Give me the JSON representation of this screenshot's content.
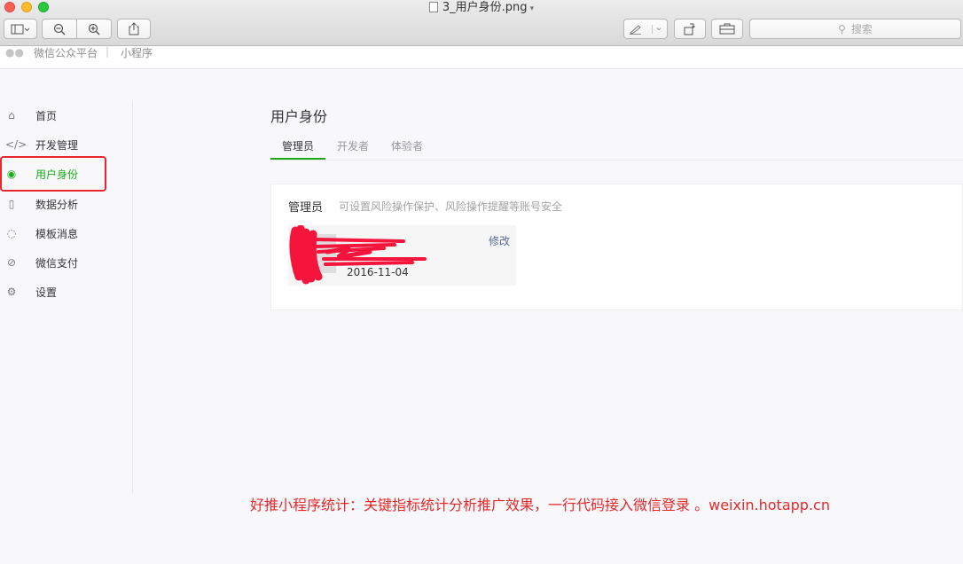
{
  "window": {
    "title": "3_用户身份.png",
    "search_placeholder": "搜索"
  },
  "topnav": {
    "brand": "微信公众平台",
    "separator": "|",
    "section": "小程序"
  },
  "sidebar": {
    "items": [
      {
        "label": "首页",
        "icon": "home-icon"
      },
      {
        "label": "开发管理",
        "icon": "code-icon"
      },
      {
        "label": "用户身份",
        "icon": "user-icon"
      },
      {
        "label": "数据分析",
        "icon": "chart-doc-icon"
      },
      {
        "label": "模板消息",
        "icon": "message-icon"
      },
      {
        "label": "微信支付",
        "icon": "payment-icon"
      },
      {
        "label": "设置",
        "icon": "gear-icon"
      }
    ],
    "active_index": 2
  },
  "main": {
    "title": "用户身份",
    "tabs": [
      {
        "label": "管理员"
      },
      {
        "label": "开发者"
      },
      {
        "label": "体验者"
      }
    ],
    "card": {
      "label": "管理员",
      "description": "可设置风险操作保护、风险操作提醒等账号安全",
      "member": {
        "date": "2016-11-04",
        "edit_label": "修改"
      }
    }
  },
  "promo": {
    "text": "好推小程序统计：关键指标统计分析推广效果，一行代码接入微信登录 。weixin.hotapp.cn"
  },
  "colors": {
    "accent": "#1aad19",
    "annotation_red": "#e8272b",
    "link": "#576b95"
  }
}
